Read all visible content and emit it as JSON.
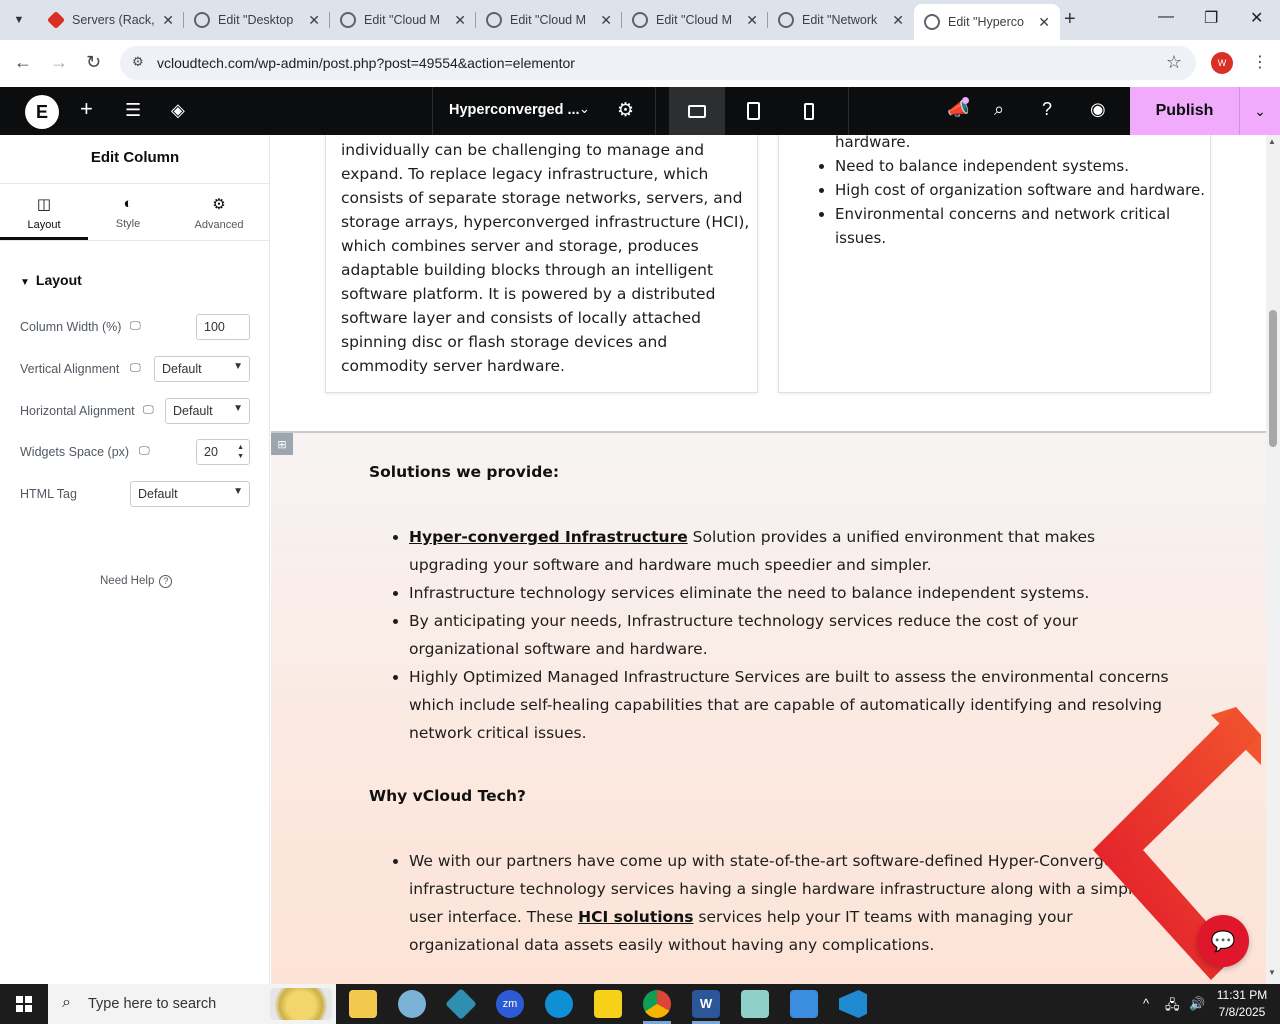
{
  "browser": {
    "tabs": [
      {
        "title": "Servers (Rack,",
        "icon": "diamond-favicon"
      },
      {
        "title": "Edit \"Desktop",
        "icon": "globe-favicon"
      },
      {
        "title": "Edit \"Cloud M",
        "icon": "globe-favicon"
      },
      {
        "title": "Edit \"Cloud M",
        "icon": "globe-favicon"
      },
      {
        "title": "Edit \"Cloud M",
        "icon": "globe-favicon"
      },
      {
        "title": "Edit \"Network",
        "icon": "globe-favicon"
      },
      {
        "title": "Edit \"Hyperco",
        "icon": "globe-favicon",
        "active": true
      }
    ],
    "url": "vcloudtech.com/wp-admin/post.php?post=49554&action=elementor",
    "profile_initial": "W"
  },
  "elementor": {
    "document_title": "Hyperconverged ...",
    "publish_label": "Publish",
    "accent": "#f0abfc"
  },
  "panel": {
    "title": "Edit Column",
    "tabs": [
      {
        "label": "Layout",
        "icon": "columns-icon"
      },
      {
        "label": "Style",
        "icon": "half-circle-icon"
      },
      {
        "label": "Advanced",
        "icon": "gear-icon"
      }
    ],
    "section": "Layout",
    "controls": {
      "column_width": {
        "label": "Column Width (%)",
        "value": "100"
      },
      "vertical_alignment": {
        "label": "Vertical Alignment",
        "value": "Default"
      },
      "horizontal_alignment": {
        "label": "Horizontal Alignment",
        "value": "Default"
      },
      "widgets_space": {
        "label": "Widgets Space (px)",
        "value": "20"
      },
      "html_tag": {
        "label": "HTML Tag",
        "value": "Default"
      }
    },
    "need_help": "Need Help"
  },
  "canvas": {
    "left_card_text": "individually can be challenging to manage and expand. To replace legacy infrastructure, which consists of separate storage networks, servers, and storage arrays, hyperconverged infrastructure (HCI), which combines server and storage, produces adaptable building blocks through an intelligent software platform. It is powered by a distributed software layer and consists of locally attached spinning disc or flash storage devices and commodity server hardware.",
    "right_card_partial": "hardware.",
    "right_card_items": [
      "Need to balance independent systems.",
      "High cost of organization software and hardware.",
      "Environmental concerns and network critical issues."
    ],
    "solutions_heading": "Solutions we provide:",
    "solutions": {
      "item1_link": "Hyper-converged Infrastructure",
      "item1_rest": " Solution provides a unified environment that makes upgrading your software and hardware much speedier and simpler.",
      "item2": "Infrastructure technology services eliminate the need to balance independent systems.",
      "item3": "By anticipating your needs, Infrastructure technology services reduce the cost of your organizational software and hardware.",
      "item4": "Highly Optimized Managed Infrastructure Services are built to assess the environmental concerns which include self-healing capabilities that are capable of automatically identifying and resolving network critical issues."
    },
    "why_heading": "Why vCloud Tech?",
    "why": {
      "before_link": "We with our partners have come up with state-of-the-art software-defined Hyper-Converged infrastructure technology services having a single hardware infrastructure along with a simplified user interface. These ",
      "link": "HCI solutions",
      "after_link": " services help your IT teams with managing your organizational data assets easily without having any complications."
    }
  },
  "taskbar": {
    "search_placeholder": "Type here to search",
    "time": "11:31 PM",
    "date": "7/8/2025",
    "apps": [
      "file-explorer-icon",
      "snipping-tool-icon",
      "app-icon",
      "zoom-icon",
      "edge-icon",
      "sticky-notes-icon",
      "chrome-icon",
      "word-icon",
      "app-icon",
      "paint-icon",
      "vscode-icon"
    ]
  }
}
